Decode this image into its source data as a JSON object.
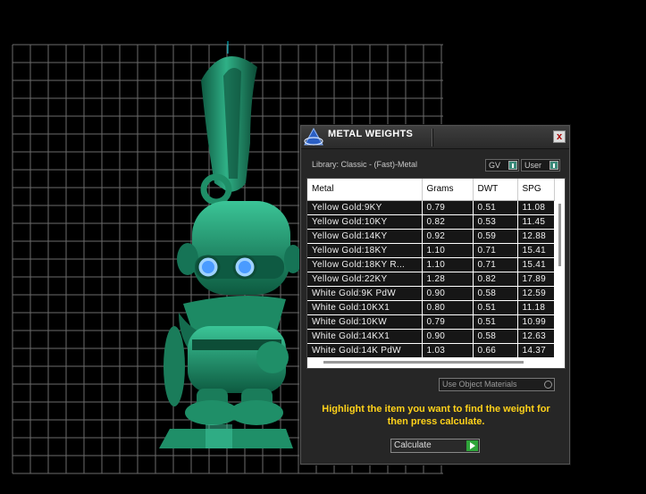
{
  "dialog": {
    "title": "METAL WEIGHTS",
    "close_label": "x",
    "library_label": "Library: Classic - (Fast)-Metal",
    "gv_select": "GV",
    "user_select": "User",
    "columns": [
      "Metal",
      "Grams",
      "DWT",
      "SPG"
    ],
    "rows": [
      [
        "Yellow Gold:9KY",
        "0.79",
        "0.51",
        "11.08"
      ],
      [
        "Yellow Gold:10KY",
        "0.82",
        "0.53",
        "11.45"
      ],
      [
        "Yellow Gold:14KY",
        "0.92",
        "0.59",
        "12.88"
      ],
      [
        "Yellow Gold:18KY",
        "1.10",
        "0.71",
        "15.41"
      ],
      [
        "Yellow Gold:18KY R...",
        "1.10",
        "0.71",
        "15.41"
      ],
      [
        "Yellow Gold:22KY",
        "1.28",
        "0.82",
        "17.89"
      ],
      [
        "White Gold:9K PdW",
        "0.90",
        "0.58",
        "12.59"
      ],
      [
        "White Gold:10KX1",
        "0.80",
        "0.51",
        "11.18"
      ],
      [
        "White Gold:10KW",
        "0.79",
        "0.51",
        "10.99"
      ],
      [
        "White Gold:14KX1",
        "0.90",
        "0.58",
        "12.63"
      ],
      [
        "White Gold:14K PdW",
        "1.03",
        "0.66",
        "14.37"
      ]
    ],
    "use_object_materials": "Use Object Materials",
    "hint": "Highlight the item you want to find the weight for then press calculate.",
    "calculate_label": "Calculate"
  },
  "colors": {
    "model_green": "#1f8f68",
    "hint_yellow": "#ffd21a",
    "goggle_blue": "#4a9bff"
  }
}
